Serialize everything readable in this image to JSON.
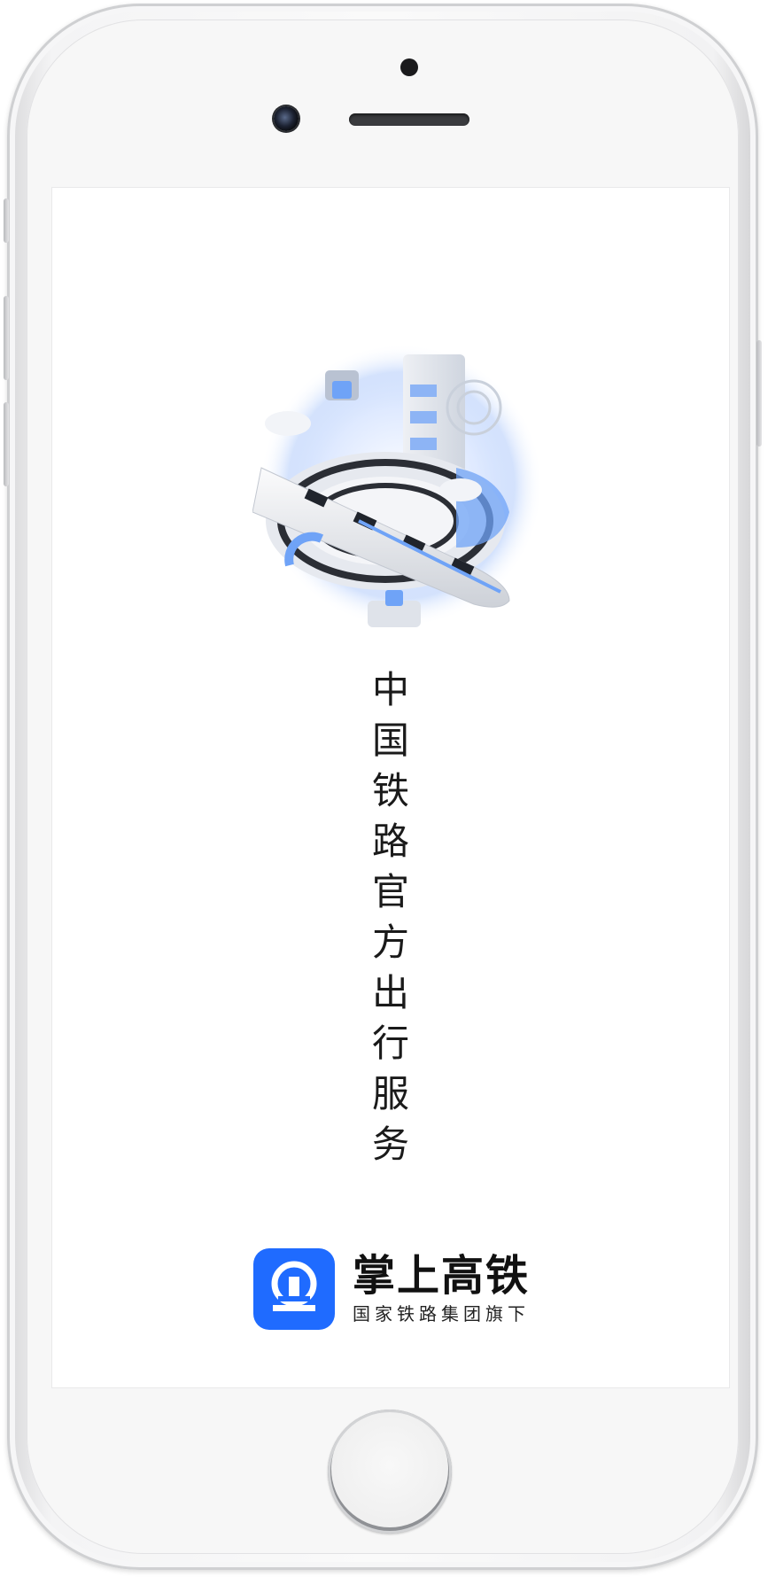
{
  "splash": {
    "slogan_chars": [
      "中",
      "国",
      "铁",
      "路",
      "官",
      "方",
      "出",
      "行",
      "服",
      "务"
    ],
    "illustration_icon": "high-speed-rail-illustration"
  },
  "brand": {
    "logo_icon": "china-railway-logo-icon",
    "name": "掌上高铁",
    "subtitle": "国家铁路集团旗下"
  },
  "colors": {
    "brand_blue": "#1f6bff",
    "illustration_blue": "#6fa3f7",
    "text": "#1a1a1a"
  }
}
